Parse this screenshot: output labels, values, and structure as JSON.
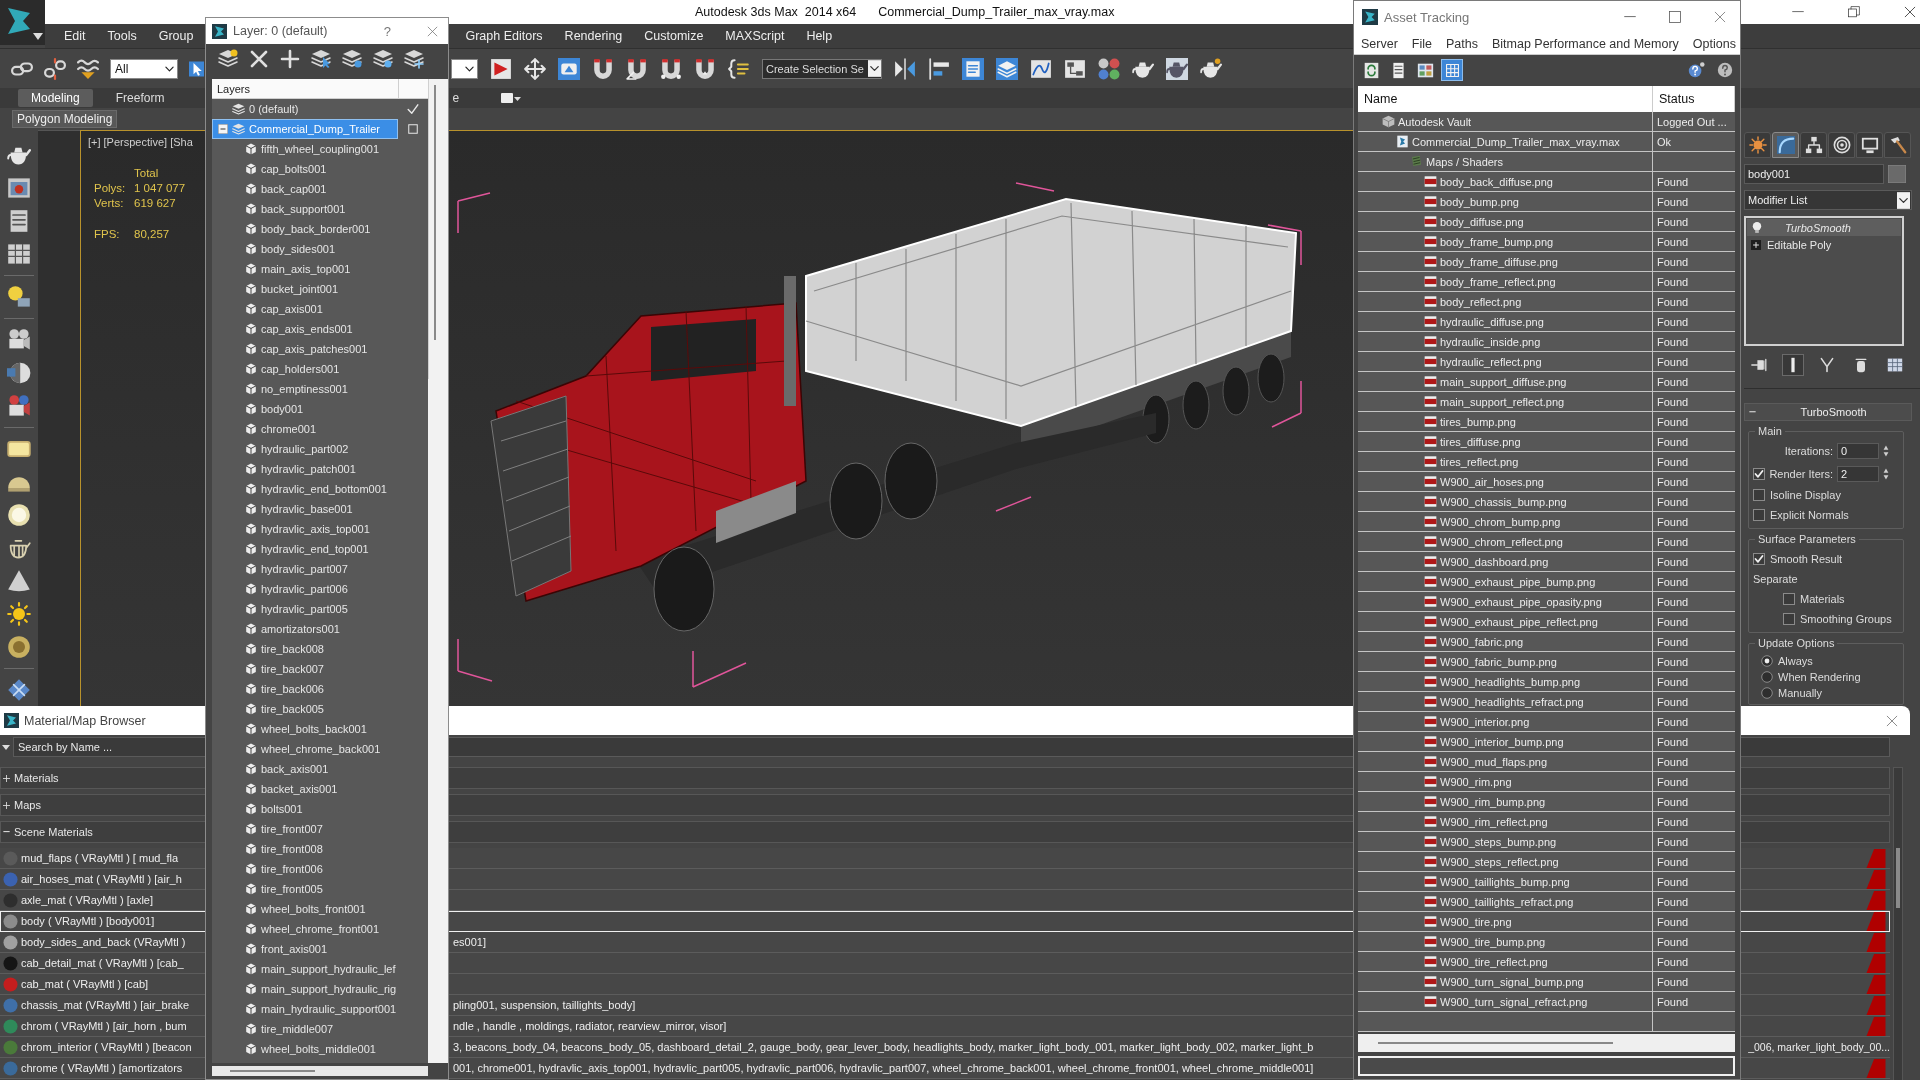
{
  "window": {
    "title": "Autodesk 3ds Max  2014 x64",
    "file_name": "Commercial_Dump_Trailer_max_vray.max"
  },
  "menu_bar": [
    {
      "label": "Edit"
    },
    {
      "label": "Tools"
    },
    {
      "label": "Group"
    },
    {
      "label": "Graph Editors"
    },
    {
      "label": "Rendering"
    },
    {
      "label": "Customize"
    },
    {
      "label": "MAXScript"
    },
    {
      "label": "Help"
    }
  ],
  "main_toolbar": {
    "selection_filter": "All",
    "named_selection_set": "Create Selection Se"
  },
  "ribbon": {
    "tabs": [
      {
        "label": "Modeling",
        "selected": true
      },
      {
        "label": "Freeform",
        "selected": false
      },
      {
        "label": "e",
        "selected": false
      }
    ],
    "panel_label": "Polygon Modeling"
  },
  "viewport": {
    "labels": [
      "[+]",
      "[Perspective]",
      "[Sha"
    ],
    "stats_header": "Total",
    "stats": [
      {
        "label": "Polys:",
        "value": "1 047 077"
      },
      {
        "label": "Verts:",
        "value": "619 627"
      },
      {
        "label": "FPS:",
        "value": "80,257"
      }
    ]
  },
  "command_panel": {
    "tabs": [
      {
        "kind": "create",
        "selected": false
      },
      {
        "kind": "modify",
        "selected": true
      },
      {
        "kind": "hierarchy",
        "selected": false
      },
      {
        "kind": "motion",
        "selected": false
      },
      {
        "kind": "display",
        "selected": false
      },
      {
        "kind": "utilities",
        "selected": false
      }
    ],
    "object_name": "body001",
    "modifier_list": "Modifier List",
    "stack": [
      {
        "kind": "modifier",
        "label": "TurboSmooth",
        "selected": true
      },
      {
        "kind": "base",
        "label": "Editable Poly",
        "selected": false
      }
    ],
    "stack_tools": [
      {
        "kind": "pin",
        "selected": false
      },
      {
        "kind": "end_result",
        "selected": true
      },
      {
        "kind": "make_unique",
        "selected": false
      },
      {
        "kind": "remove",
        "selected": false
      },
      {
        "kind": "configure",
        "selected": false
      }
    ],
    "rollout": {
      "title": "TurboSmooth",
      "expanded": true,
      "groups": [
        {
          "title": "Main",
          "controls": [
            {
              "kind": "spinner",
              "label": "Iterations:",
              "value": "0"
            },
            {
              "kind": "check_spinner",
              "label": "Render Iters:",
              "value": "2",
              "checked": true
            },
            {
              "kind": "checkbox",
              "label": "Isoline Display",
              "checked": false
            },
            {
              "kind": "checkbox",
              "label": "Explicit Normals",
              "checked": false
            }
          ]
        },
        {
          "title": "Surface Parameters",
          "controls": [
            {
              "kind": "checkbox",
              "label": "Smooth Result",
              "checked": true
            },
            {
              "kind": "label",
              "label": "Separate",
              "children": [
                {
                  "kind": "checkbox",
                  "label": "Materials",
                  "checked": false
                },
                {
                  "kind": "checkbox",
                  "label": "Smoothing Groups",
                  "checked": false
                }
              ]
            }
          ]
        },
        {
          "title": "Update Options",
          "controls": [
            {
              "kind": "radio",
              "label": "Always",
              "selected": true
            },
            {
              "kind": "radio",
              "label": "When Rendering",
              "selected": false
            },
            {
              "kind": "radio",
              "label": "Manually",
              "selected": false
            }
          ]
        }
      ]
    }
  },
  "layer_dialog": {
    "title": "Layer: 0 (default)",
    "help_button": "?",
    "header": "Layers",
    "layers": [
      {
        "name": "0 (default)",
        "selected": false,
        "current": true
      },
      {
        "name": "Commercial_Dump_Trailer",
        "selected": true,
        "current": false,
        "expanded": true,
        "children": [
          {
            "name": "fifth_wheel_coupling001",
            "selected": false
          },
          {
            "name": "cap_bolts001",
            "selected": false
          },
          {
            "name": "back_cap001",
            "selected": false
          },
          {
            "name": "back_support001",
            "selected": false
          },
          {
            "name": "body_back_border001",
            "selected": false
          },
          {
            "name": "body_sides001",
            "selected": false
          },
          {
            "name": "main_axis_top001",
            "selected": false
          },
          {
            "name": "bucket_joint001",
            "selected": false
          },
          {
            "name": "cap_axis001",
            "selected": false
          },
          {
            "name": "cap_axis_ends001",
            "selected": false
          },
          {
            "name": "cap_axis_patches001",
            "selected": false
          },
          {
            "name": "cap_holders001",
            "selected": false
          },
          {
            "name": "no_emptiness001",
            "selected": false
          },
          {
            "name": "body001",
            "selected": false
          },
          {
            "name": "chrome001",
            "selected": false
          },
          {
            "name": "hydraulic_part002",
            "selected": false
          },
          {
            "name": "hydravlic_patch001",
            "selected": false
          },
          {
            "name": "hydravlic_end_bottom001",
            "selected": false
          },
          {
            "name": "hydravlic_base001",
            "selected": false
          },
          {
            "name": "hydravlic_axis_top001",
            "selected": false
          },
          {
            "name": "hydravlic_end_top001",
            "selected": false
          },
          {
            "name": "hydravlic_part007",
            "selected": false
          },
          {
            "name": "hydravlic_part006",
            "selected": false
          },
          {
            "name": "hydravlic_part005",
            "selected": false
          },
          {
            "name": "amortizators001",
            "selected": false
          },
          {
            "name": "tire_back008",
            "selected": false
          },
          {
            "name": "tire_back007",
            "selected": false
          },
          {
            "name": "tire_back006",
            "selected": false
          },
          {
            "name": "tire_back005",
            "selected": false
          },
          {
            "name": "wheel_bolts_back001",
            "selected": false
          },
          {
            "name": "wheel_chrome_back001",
            "selected": false
          },
          {
            "name": "back_axis001",
            "selected": false
          },
          {
            "name": "backet_axis001",
            "selected": false
          },
          {
            "name": "bolts001",
            "selected": false
          },
          {
            "name": "tire_front007",
            "selected": false
          },
          {
            "name": "tire_front008",
            "selected": false
          },
          {
            "name": "tire_front006",
            "selected": false
          },
          {
            "name": "tire_front005",
            "selected": false
          },
          {
            "name": "wheel_bolts_front001",
            "selected": false
          },
          {
            "name": "wheel_chrome_front001",
            "selected": false
          },
          {
            "name": "front_axis001",
            "selected": false
          },
          {
            "name": "main_support_hydraulic_lef",
            "selected": false
          },
          {
            "name": "main_support_hydraulic_rig",
            "selected": false
          },
          {
            "name": "main_hydraulic_support001",
            "selected": false
          },
          {
            "name": "tire_middle007",
            "selected": false
          },
          {
            "name": "wheel_bolts_middle001",
            "selected": false
          }
        ]
      }
    ]
  },
  "asset_tracking": {
    "title": "Asset Tracking",
    "menu": [
      "Server",
      "File",
      "Paths",
      "Bitmap Performance and Memory",
      "Options"
    ],
    "view_buttons": [
      {
        "kind": "refresh",
        "selected": false
      },
      {
        "kind": "list",
        "selected": false
      },
      {
        "kind": "thumbnails",
        "selected": false
      },
      {
        "kind": "table",
        "selected": true
      }
    ],
    "columns": [
      "Name",
      "Status"
    ],
    "tree": [
      {
        "kind": "vault",
        "name": "Autodesk Vault",
        "status": "Logged Out ...",
        "children": [
          {
            "kind": "max",
            "name": "Commercial_Dump_Trailer_max_vray.max",
            "status": "Ok",
            "children": [
              {
                "kind": "maps",
                "name": "Maps / Shaders",
                "children": [
                  {
                    "kind": "png",
                    "name": "body_back_diffuse.png",
                    "status": "Found"
                  },
                  {
                    "kind": "png",
                    "name": "body_bump.png",
                    "status": "Found"
                  },
                  {
                    "kind": "png",
                    "name": "body_diffuse.png",
                    "status": "Found"
                  },
                  {
                    "kind": "png",
                    "name": "body_frame_bump.png",
                    "status": "Found"
                  },
                  {
                    "kind": "png",
                    "name": "body_frame_diffuse.png",
                    "status": "Found"
                  },
                  {
                    "kind": "png",
                    "name": "body_frame_reflect.png",
                    "status": "Found"
                  },
                  {
                    "kind": "png",
                    "name": "body_reflect.png",
                    "status": "Found"
                  },
                  {
                    "kind": "png",
                    "name": "hydraulic_diffuse.png",
                    "status": "Found"
                  },
                  {
                    "kind": "png",
                    "name": "hydraulic_inside.png",
                    "status": "Found"
                  },
                  {
                    "kind": "png",
                    "name": "hydraulic_reflect.png",
                    "status": "Found"
                  },
                  {
                    "kind": "png",
                    "name": "main_support_diffuse.png",
                    "status": "Found"
                  },
                  {
                    "kind": "png",
                    "name": "main_support_reflect.png",
                    "status": "Found"
                  },
                  {
                    "kind": "png",
                    "name": "tires_bump.png",
                    "status": "Found"
                  },
                  {
                    "kind": "png",
                    "name": "tires_diffuse.png",
                    "status": "Found"
                  },
                  {
                    "kind": "png",
                    "name": "tires_reflect.png",
                    "status": "Found"
                  },
                  {
                    "kind": "png",
                    "name": "W900_air_hoses.png",
                    "status": "Found"
                  },
                  {
                    "kind": "png",
                    "name": "W900_chassis_bump.png",
                    "status": "Found"
                  },
                  {
                    "kind": "png",
                    "name": "W900_chrom_bump.png",
                    "status": "Found"
                  },
                  {
                    "kind": "png",
                    "name": "W900_chrom_reflect.png",
                    "status": "Found"
                  },
                  {
                    "kind": "png",
                    "name": "W900_dashboard.png",
                    "status": "Found"
                  },
                  {
                    "kind": "png",
                    "name": "W900_exhaust_pipe_bump.png",
                    "status": "Found"
                  },
                  {
                    "kind": "png",
                    "name": "W900_exhaust_pipe_opasity.png",
                    "status": "Found"
                  },
                  {
                    "kind": "png",
                    "name": "W900_exhaust_pipe_reflect.png",
                    "status": "Found"
                  },
                  {
                    "kind": "png",
                    "name": "W900_fabric.png",
                    "status": "Found"
                  },
                  {
                    "kind": "png",
                    "name": "W900_fabric_bump.png",
                    "status": "Found"
                  },
                  {
                    "kind": "png",
                    "name": "W900_headlights_bump.png",
                    "status": "Found"
                  },
                  {
                    "kind": "png",
                    "name": "W900_headlights_refract.png",
                    "status": "Found"
                  },
                  {
                    "kind": "png",
                    "name": "W900_interior.png",
                    "status": "Found"
                  },
                  {
                    "kind": "png",
                    "name": "W900_interior_bump.png",
                    "status": "Found"
                  },
                  {
                    "kind": "png",
                    "name": "W900_mud_flaps.png",
                    "status": "Found"
                  },
                  {
                    "kind": "png",
                    "name": "W900_rim.png",
                    "status": "Found"
                  },
                  {
                    "kind": "png",
                    "name": "W900_rim_bump.png",
                    "status": "Found"
                  },
                  {
                    "kind": "png",
                    "name": "W900_rim_reflect.png",
                    "status": "Found"
                  },
                  {
                    "kind": "png",
                    "name": "W900_steps_bump.png",
                    "status": "Found"
                  },
                  {
                    "kind": "png",
                    "name": "W900_steps_reflect.png",
                    "status": "Found"
                  },
                  {
                    "kind": "png",
                    "name": "W900_taillights_bump.png",
                    "status": "Found"
                  },
                  {
                    "kind": "png",
                    "name": "W900_taillights_refract.png",
                    "status": "Found"
                  },
                  {
                    "kind": "png",
                    "name": "W900_tire.png",
                    "status": "Found"
                  },
                  {
                    "kind": "png",
                    "name": "W900_tire_bump.png",
                    "status": "Found"
                  },
                  {
                    "kind": "png",
                    "name": "W900_tire_reflect.png",
                    "status": "Found"
                  },
                  {
                    "kind": "png",
                    "name": "W900_turn_signal_bump.png",
                    "status": "Found"
                  },
                  {
                    "kind": "png",
                    "name": "W900_turn_signal_refract.png",
                    "status": "Found"
                  }
                ]
              }
            ]
          }
        ]
      }
    ]
  },
  "material_browser": {
    "title": "Material/Map Browser",
    "search": {
      "placeholder": "Search by Name ..."
    },
    "sections": [
      {
        "label": "Materials",
        "expanded": false
      },
      {
        "label": "Maps",
        "expanded": false
      },
      {
        "label": "Scene Materials",
        "expanded": true
      }
    ],
    "materials": [
      {
        "text_left": "mud_flaps ( VRayMtl ) [ mud_fla",
        "color": "#5a5a5a",
        "selected": false
      },
      {
        "text_left": "air_hoses_mat ( VRayMtl ) [air_h",
        "color": "#3b62b0",
        "selected": false
      },
      {
        "text_left": "axle_mat ( VRayMtl ) [axle]",
        "color": "#2e2e2e",
        "selected": false
      },
      {
        "text_left": "body ( VRayMtl ) [body001]",
        "color": "#8c8c8c",
        "selected": true
      },
      {
        "text_left": "body_sides_and_back (VRayMtl )",
        "text_middle": "es001]",
        "color": "#a0a0a0",
        "selected": false
      },
      {
        "text_left": "cab_detail_mat ( VRayMtl ) [cab_",
        "color": "#151515",
        "selected": false
      },
      {
        "text_left": "cab_mat ( VRayMtl ) [cab]",
        "color": "#c41e1e",
        "selected": false
      },
      {
        "text_left": "chassis_mat (VRayMtl ) [air_brake",
        "text_middle": "pling001, suspension, taillights_body]",
        "color": "#3f6fa8",
        "selected": false
      },
      {
        "text_left": "chrom ( VRayMtl ) [air_horn , bum",
        "text_middle": "ndle , handle , moldings, radiator, rearview_mirror, visor]",
        "color": "#2f8a5a",
        "selected": false
      },
      {
        "text_left": "chrom_interior ( VRayMtl ) [beacon",
        "text_middle": "3, beacons_body_04, beacons_body_05, dashboard_detail_2, gauge_body, gear_lever_body, headlights_body, marker_light_body_001, marker_light_body_002, marker_light_b",
        "text_right": "_006, marker_light_body_00...",
        "color": "#4a7a3a",
        "selected": false
      },
      {
        "text_left": "chrome ( VRayMtl ) [amortizators",
        "text_middle": "001, chrome001, hydravlic_axis_top001, hydravlic_part005, hydravlic_part006, hydravlic_part007, wheel_chrome_back001, wheel_chrome_front001, wheel_chrome_middle001]",
        "color": "#3a6a9a",
        "selected": false
      }
    ]
  }
}
